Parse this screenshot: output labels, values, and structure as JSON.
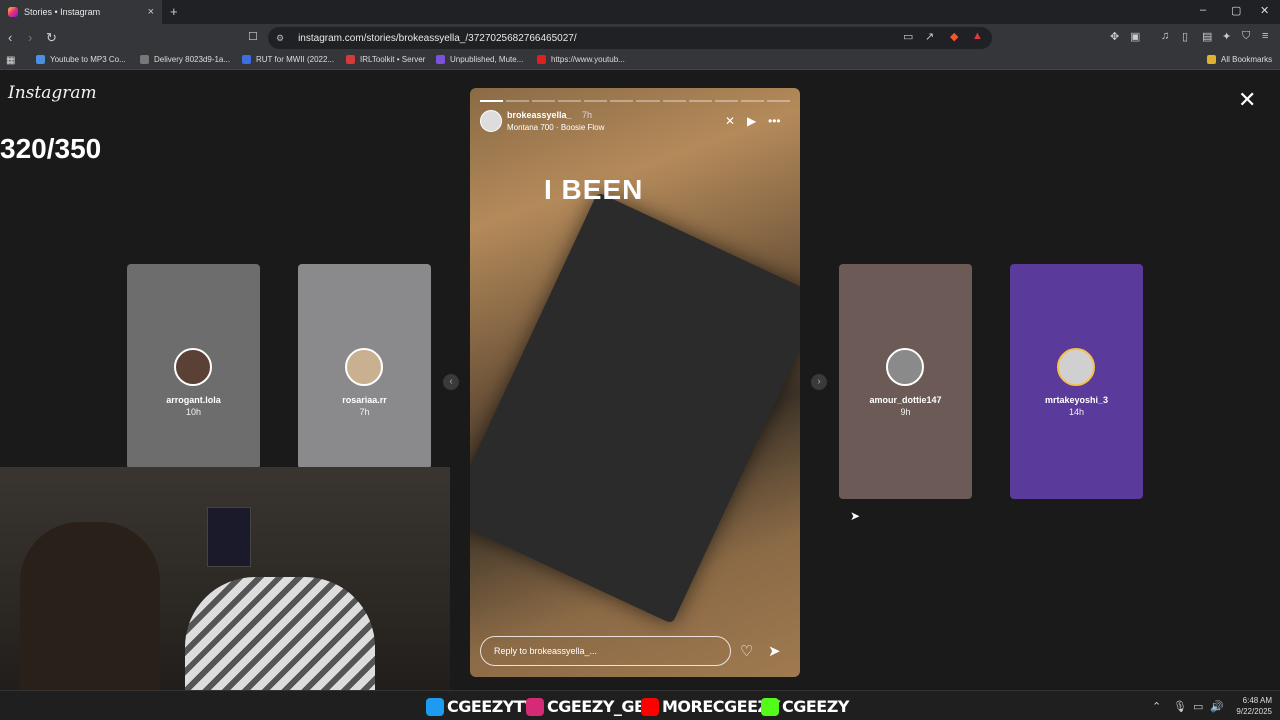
{
  "browser": {
    "tab_title": "Stories • Instagram",
    "tab_close": "×",
    "new_tab": "+",
    "url": "instagram.com/stories/brokeassyella_/3727025682766465027/",
    "window_controls": [
      "–",
      "▢",
      "✕"
    ]
  },
  "bookmarks": [
    {
      "label": "Youtube to MP3 Co...",
      "color": "#4a8fe0"
    },
    {
      "label": "Delivery 8023d9-1a...",
      "color": "#777777"
    },
    {
      "label": "RUT for MWII (2022...",
      "color": "#3b6fe0"
    },
    {
      "label": "IRLToolkit • Server",
      "color": "#d33b3b"
    },
    {
      "label": "Unpublished, Mute...",
      "color": "#7b52d9"
    },
    {
      "label": "https://www.youtub...",
      "color": "#e02020"
    }
  ],
  "all_bookmarks": "All Bookmarks",
  "instagram": {
    "logo": "Instagram",
    "counter": "320/350",
    "close": "✕"
  },
  "side_stories": [
    {
      "user": "arrogant.lola",
      "time": "10h",
      "bg": "#6d6d6d"
    },
    {
      "user": "rosariaa.rr",
      "time": "7h",
      "bg": "#8a8a8c"
    },
    {
      "user": "amour_dottie147",
      "time": "9h",
      "bg": "#6b5a55"
    },
    {
      "user": "mrtakeyoshi_3",
      "time": "14h",
      "bg": "#5a3a9a"
    }
  ],
  "story": {
    "user": "brokeassyella_",
    "time": "7h",
    "music": "Montana 700 · Boosie Flow",
    "text": "I BEEN",
    "reply_placeholder": "Reply to brokeassyella_..."
  },
  "taskbar": {
    "socials": [
      {
        "label": "CGEEZYTV",
        "color": "#1d9bf0"
      },
      {
        "label": "CGEEZY_GBC",
        "color": "#d62976"
      },
      {
        "label": "MORECGEEZY",
        "color": "#ff0000"
      },
      {
        "label": "CGEEZY",
        "color": "#53fc18"
      }
    ],
    "time": "6:48 AM",
    "date": "9/22/2025"
  }
}
